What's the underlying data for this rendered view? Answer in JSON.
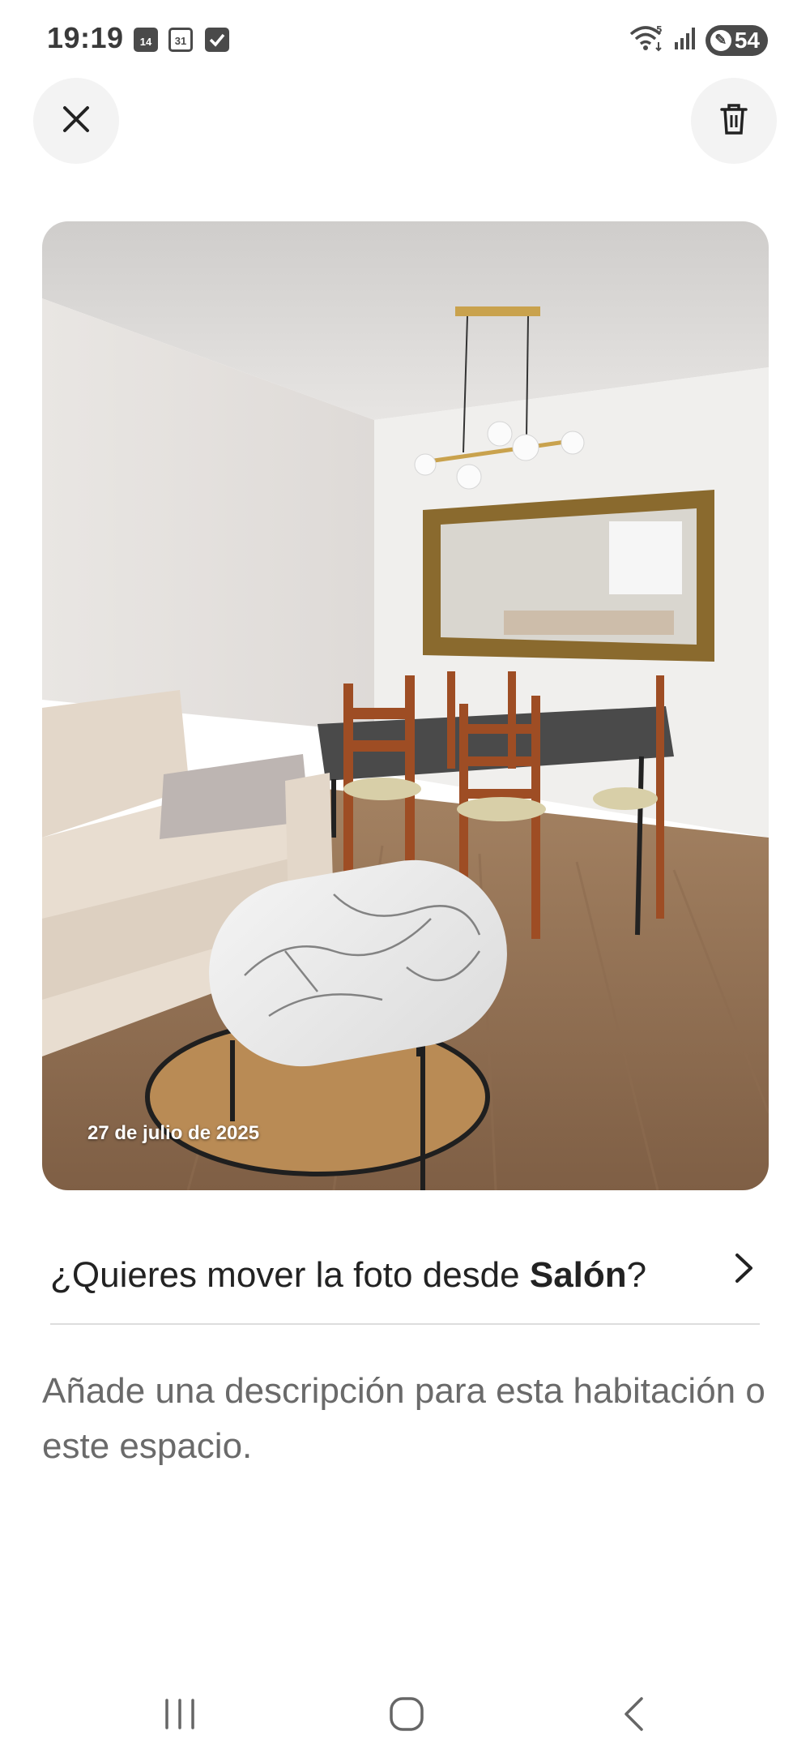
{
  "status_bar": {
    "time": "19:19",
    "notif_calendar_day": "14",
    "notif_calendar_date": "31",
    "battery_level": "54",
    "icons": [
      "calendar-14-icon",
      "calendar-31-icon",
      "checkbox-icon",
      "wifi-icon",
      "signal-icon",
      "battery-saver-icon"
    ]
  },
  "header": {
    "close_icon": "close-icon",
    "delete_icon": "trash-icon"
  },
  "photo": {
    "date_label": "27 de julio de 2025"
  },
  "move_photo": {
    "prefix": "¿Quieres mover la foto desde ",
    "room": "Salón",
    "suffix": "?",
    "icon": "chevron-right-icon"
  },
  "description": {
    "placeholder": "Añade una descripción para esta habitación o este espacio."
  },
  "nav_bar": {
    "icons": [
      "recent-apps-icon",
      "home-icon",
      "back-icon"
    ]
  },
  "colors": {
    "text_primary": "#222222",
    "text_secondary": "#6a6a6a",
    "button_bg": "#f3f3f3",
    "divider": "#dddddd"
  }
}
